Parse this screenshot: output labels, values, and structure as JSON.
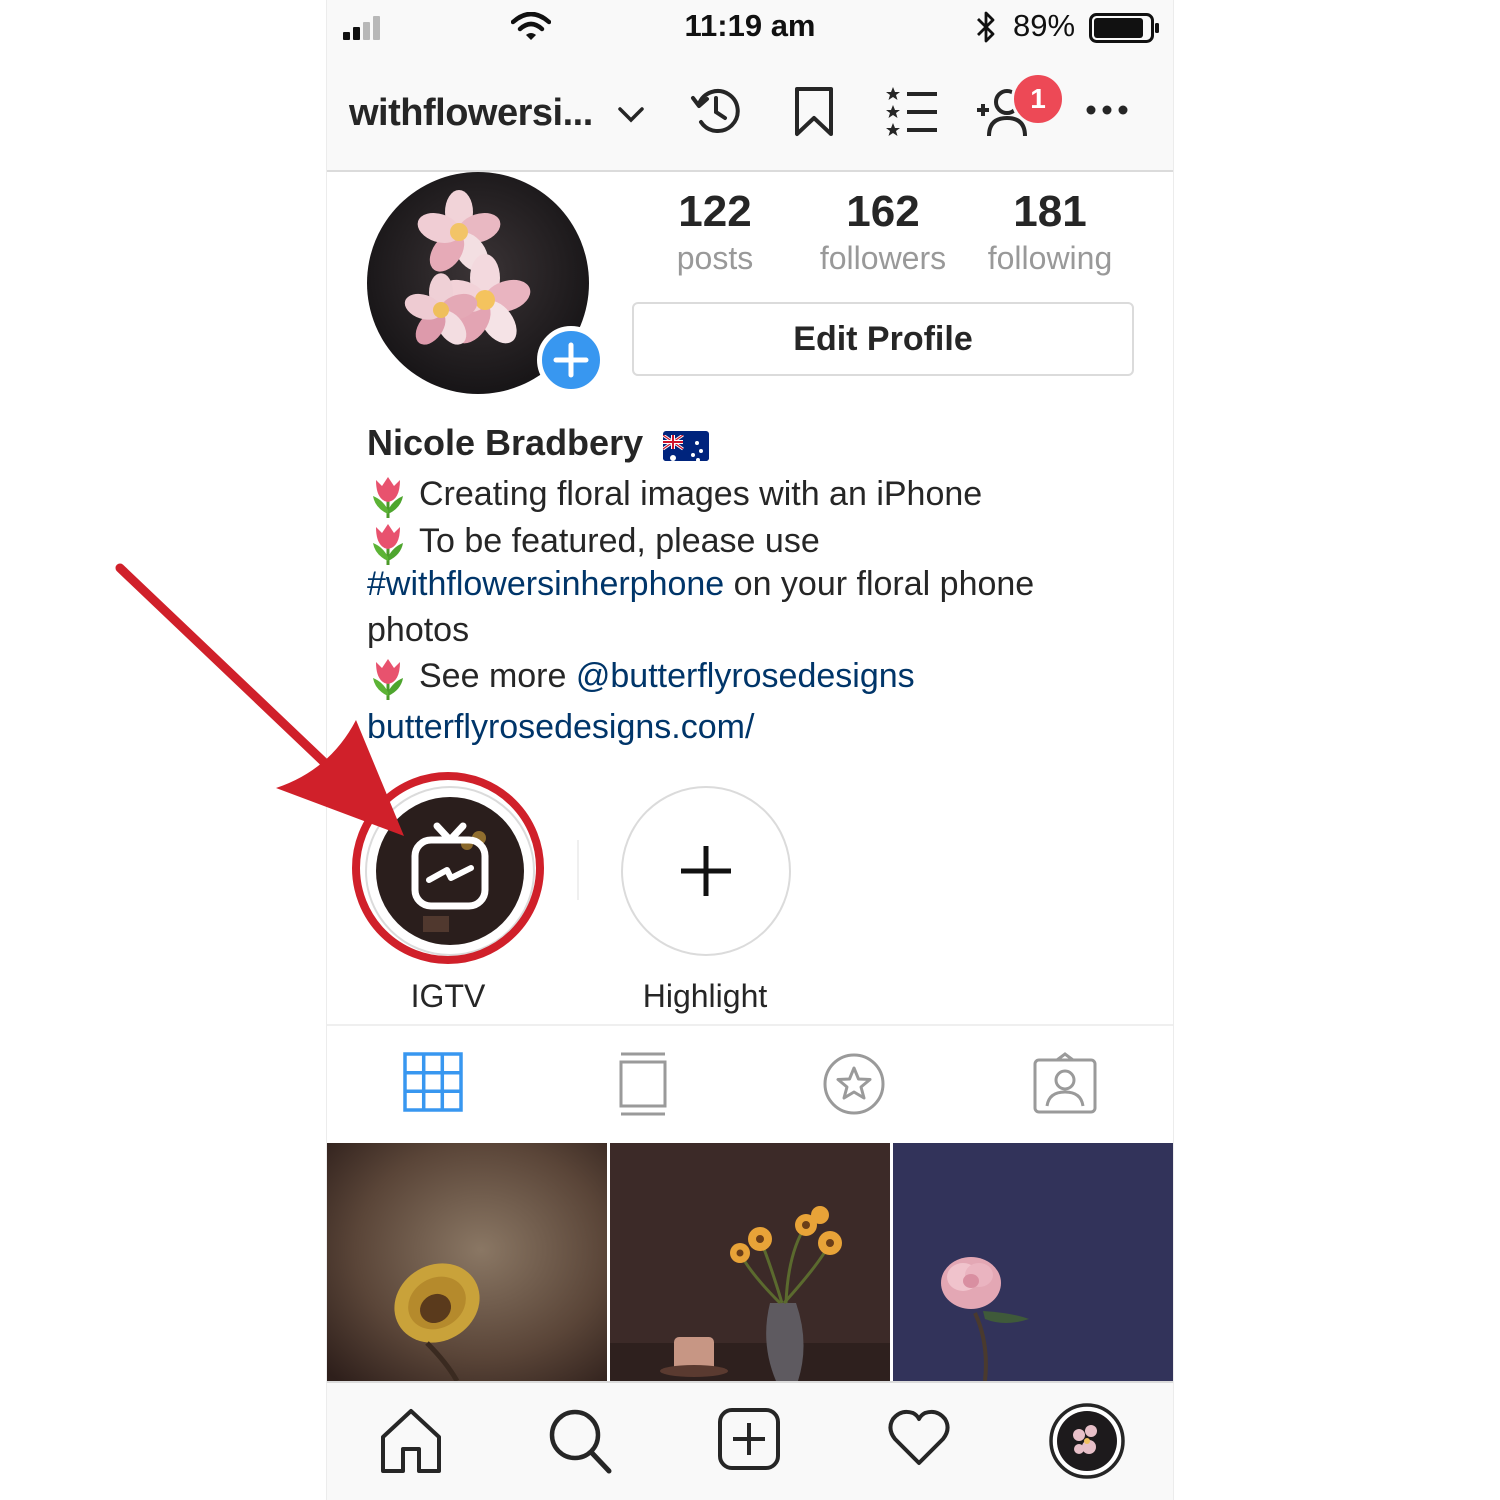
{
  "status_bar": {
    "time": "11:19 am",
    "battery_percent": "89%",
    "signal_bars": 2,
    "battery_level": 0.89
  },
  "top_nav": {
    "username": "withflowersi...",
    "notification_count": "1"
  },
  "profile": {
    "stats": [
      {
        "value": "122",
        "label": "posts"
      },
      {
        "value": "162",
        "label": "followers"
      },
      {
        "value": "181",
        "label": "following"
      }
    ],
    "edit_button": "Edit Profile",
    "display_name": "Nicole Bradbery",
    "bio": {
      "line1": "Creating floral images with an iPhone",
      "line2": "To be featured, please use",
      "hashtag": "#withflowersinherphone",
      "line3_rest": " on your floral phone",
      "line4": "photos",
      "line5_prefix": "See more ",
      "mention": "@butterflyrosedesigns",
      "website": "butterflyrosedesigns.com/"
    }
  },
  "highlights": [
    {
      "label": "IGTV"
    },
    {
      "label": "Highlight"
    }
  ],
  "colors": {
    "accent": "#3897f0",
    "badge": "#ed4956",
    "link": "#003569",
    "annotation": "#d0202a"
  },
  "icons": {
    "top_nav": [
      "history-icon",
      "bookmark-icon",
      "close-friends-list-icon",
      "add-person-icon",
      "more-icon"
    ],
    "tabs": [
      "grid-icon",
      "feed-icon",
      "saved-star-icon",
      "tagged-icon"
    ],
    "bottom": [
      "home-icon",
      "search-icon",
      "new-post-icon",
      "heart-icon",
      "profile-avatar-icon"
    ]
  }
}
